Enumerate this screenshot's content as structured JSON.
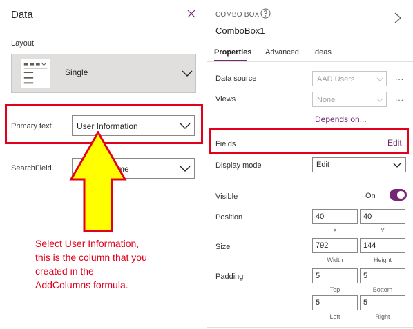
{
  "left_panel": {
    "title": "Data",
    "layout_label": "Layout",
    "layout_value": "Single",
    "primary_text_label": "Primary text",
    "primary_text_value": "User Information",
    "search_field_label": "SearchField",
    "search_field_value_visible": "me"
  },
  "annotation": {
    "lines": [
      "Select User Information,",
      "this is the column that you",
      "created in the",
      "AddColumns formula."
    ],
    "color": "#e3001b",
    "arrow_fill": "#ffff00"
  },
  "right_panel": {
    "control_type": "COMBO BOX",
    "control_name": "ComboBox1",
    "tabs": [
      "Properties",
      "Advanced",
      "Ideas"
    ],
    "active_tab": "Properties",
    "data_source_label": "Data source",
    "data_source_value": "AAD Users",
    "views_label": "Views",
    "views_value": "None",
    "more_label": "...",
    "depends_on_link": "Depends on...",
    "fields_label": "Fields",
    "fields_edit": "Edit",
    "display_mode_label": "Display mode",
    "display_mode_value": "Edit",
    "visible_label": "Visible",
    "visible_value": "On",
    "position_label": "Position",
    "position_x": "40",
    "position_y": "40",
    "x_label": "X",
    "y_label": "Y",
    "size_label": "Size",
    "width_value": "792",
    "height_value": "144",
    "width_label": "Width",
    "height_label": "Height",
    "padding_label": "Padding",
    "padding_top": "5",
    "padding_bottom": "5",
    "padding_left": "5",
    "padding_right": "5",
    "top_label": "Top",
    "bottom_label": "Bottom",
    "left_label": "Left",
    "right_label": "Right"
  },
  "colors": {
    "accent": "#742774",
    "highlight": "#e3001b"
  }
}
